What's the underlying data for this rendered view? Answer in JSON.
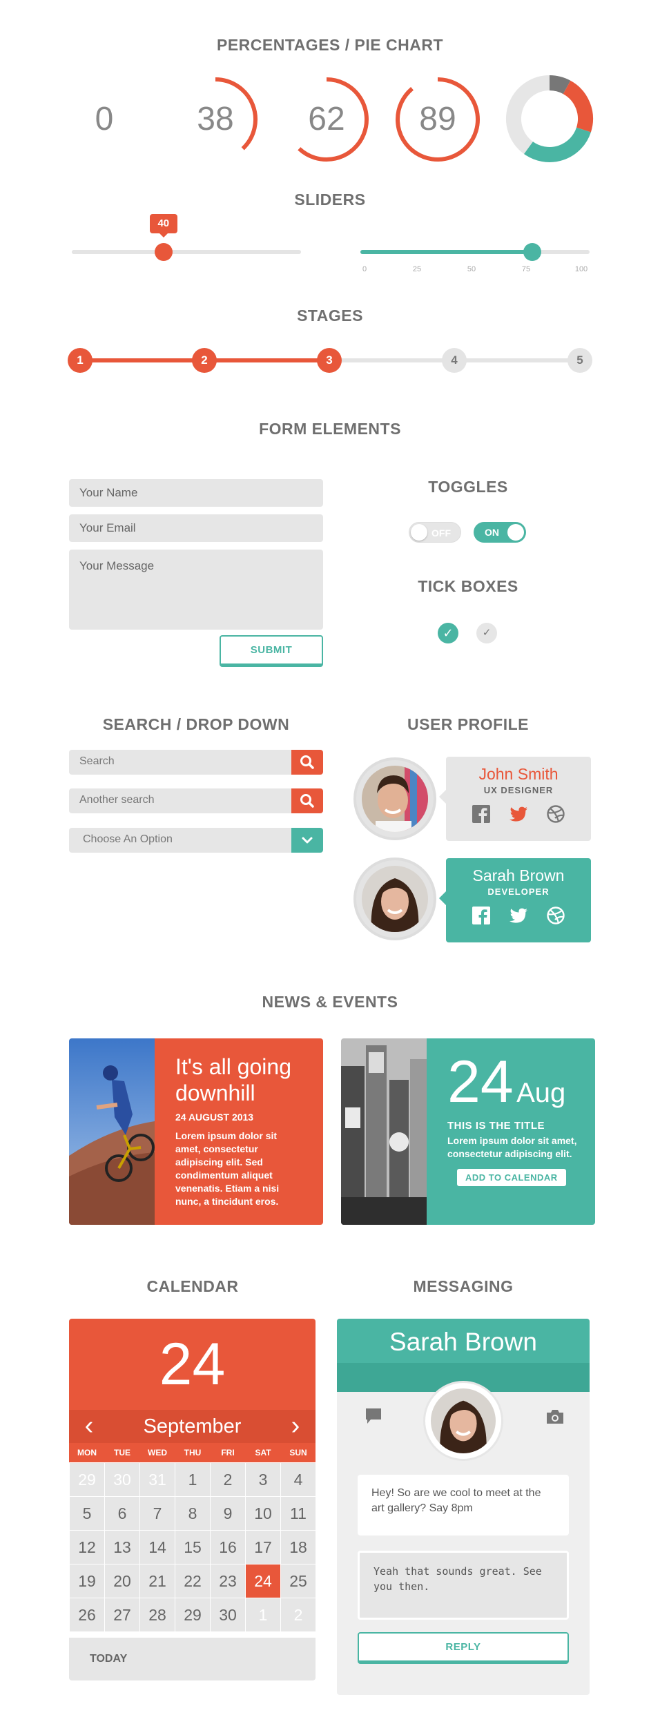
{
  "sections": {
    "percentages": "PERCENTAGES / PIE CHART",
    "sliders": "SLIDERS",
    "stages": "STAGES",
    "form": "FORM ELEMENTS",
    "toggles": "TOGGLES",
    "tickboxes": "TICK BOXES",
    "search": "SEARCH / DROP DOWN",
    "profile": "USER PROFILE",
    "news": "NEWS & EVENTS",
    "calendar": "CALENDAR",
    "messaging": "MESSAGING"
  },
  "colors": {
    "accent": "#e8573a",
    "teal": "#4ab5a3",
    "grey": "#e6e6e6",
    "darkgrey": "#777777"
  },
  "percentages": [
    {
      "label": "0",
      "value": 0
    },
    {
      "label": "38",
      "value": 38
    },
    {
      "label": "62",
      "value": 62
    },
    {
      "label": "89",
      "value": 89
    }
  ],
  "donut": [
    {
      "color": "#777777",
      "value": 8
    },
    {
      "color": "#e8573a",
      "value": 22
    },
    {
      "color": "#4ab5a3",
      "value": 30
    },
    {
      "color": "#e6e6e6",
      "value": 40
    }
  ],
  "sliders": {
    "first": {
      "value": 40,
      "min": 0,
      "max": 100,
      "bubble": "40"
    },
    "second": {
      "value": 75,
      "min": 0,
      "max": 100,
      "ticks": [
        "0",
        "25",
        "50",
        "75",
        "100"
      ]
    }
  },
  "stages": {
    "labels": [
      "1",
      "2",
      "3",
      "4",
      "5"
    ],
    "active": 3
  },
  "form": {
    "name_placeholder": "Your Name",
    "email_placeholder": "Your Email",
    "message_placeholder": "Your Message",
    "submit": "SUBMIT"
  },
  "toggles": {
    "off_label": "OFF",
    "on_label": "ON"
  },
  "search": {
    "first_placeholder": "Search",
    "second_placeholder": "Another search",
    "dropdown_selected": "Choose An Option"
  },
  "profiles": [
    {
      "name": "John Smith",
      "role": "UX DESIGNER"
    },
    {
      "name": "Sarah Brown",
      "role": "DEVELOPER"
    }
  ],
  "news": {
    "first": {
      "title": "It's all going downhill",
      "date": "24 AUGUST 2013",
      "text": "Lorem ipsum dolor sit amet, consectetur adipiscing elit. Sed condimentum aliquet venenatis. Etiam a nisi nunc, a tincidunt eros."
    },
    "second": {
      "day": "24",
      "month": "Aug",
      "title": "THIS IS THE TITLE",
      "text": "Lorem ipsum dolor sit amet, consectetur adipiscing elit.",
      "button": "ADD TO CALENDAR"
    }
  },
  "calendar": {
    "big_day": "24",
    "month": "September",
    "prev": "‹",
    "next": "›",
    "weekdays": [
      "MON",
      "TUE",
      "WED",
      "THU",
      "FRI",
      "SAT",
      "SUN"
    ],
    "days": [
      "29",
      "30",
      "31",
      "1",
      "2",
      "3",
      "4",
      "5",
      "6",
      "7",
      "8",
      "9",
      "10",
      "11",
      "12",
      "13",
      "14",
      "15",
      "16",
      "17",
      "18",
      "19",
      "20",
      "21",
      "22",
      "23",
      "24",
      "25",
      "26",
      "27",
      "28",
      "29",
      "30",
      "1",
      "2"
    ],
    "muted": [
      0,
      1,
      2,
      33,
      34
    ],
    "selected": 26,
    "today": "TODAY"
  },
  "messaging": {
    "name": "Sarah Brown",
    "incoming": "Hey! So are we cool to meet at the art gallery? Say 8pm",
    "reply_text": "Yeah that sounds great. See you then.",
    "reply_button": "REPLY"
  }
}
